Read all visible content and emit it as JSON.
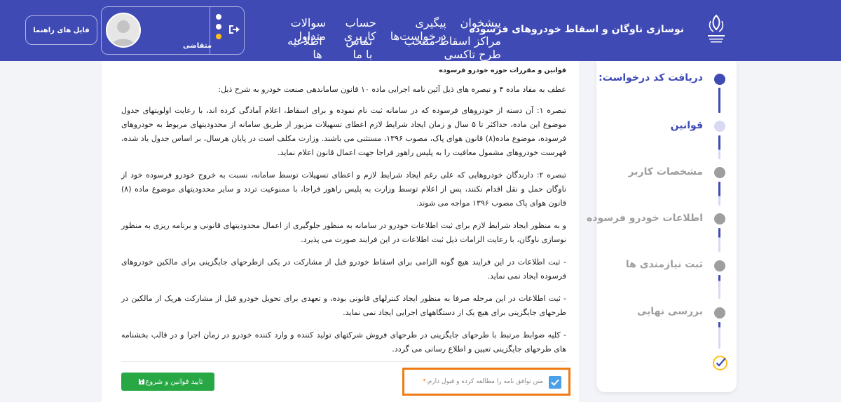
{
  "header": {
    "site_title": "نوسازی ناوگان و اسقاط خودروهای فرسوده",
    "nav_row1": [
      "پیشخوان",
      "پیگیری درخواست‌ها",
      "حساب کاربری",
      "سوالات متداول"
    ],
    "nav_row2": [
      "مراکز اسقاط منتخب طرح تاکسی",
      "تماس با ما",
      "اطلاعیه ها"
    ],
    "user_role": "متقاضی",
    "guide_button": "فایل های راهنما"
  },
  "content": {
    "doc_title": "قوانین و مقررات حوزه خودرو فرسوده",
    "paragraphs": [
      "عطف به مفاد ماده ۴ و تبصره های ذیل آئین نامه اجرایی ماده ۱۰ قانون ساماندهی صنعت خودرو به شرح ذیل:",
      "تبصره ۱: آن دسته از خودروهای فرسوده که در سامانه ثبت نام نموده و برای اسقاط، اعلام آمادگی کرده اند، با رعایت اولویتهای جدول موضوع این ماده، حداکثر تا ۵ سال و زمان ایجاد شرایط لازم اعطای تسهیلات مزبور از طریق سامانه از محدودیتهای مربوط به خودروهای فرسوده، موضوع ماده(۸) قانون هوای پاک، مصوب ۱۳۹۶، مستثنی می باشند. وزارت مکلف است در پایان هرسال، بر اساس جدول یاد شده، فهرست خودروهای مشمول معافیت را به پلیس راهور فراجا جهت اعمال قانون اعلام نماید.",
      "تبصره ۲: دارندگان خودروهایی که علی رغم ایجاد شرایط لازم و اعطای تسهیلات توسط سامانه، نسبت به خروج خودرو فرسوده خود از ناوگان حمل و نقل اقدام نکنند، پس از اعلام توسط وزارت به پلیس راهور فراجا، با ممنوعیت تردد و سایر محدودیتهای موضوع ماده (۸) قانون هوای پاک مصوب ۱۳۹۶ مواجه می شوند.",
      "و به منظور ایجاد شرایط لازم برای ثبت اطلاعات خودرو در سامانه به منظور جلوگیری از اعمال محدودیتهای قانونی و برنامه ریزی به منظور نوسازی ناوگان، با رعایت الزامات ذیل ثبت اطلاعات در این فرایند صورت می پذیرد.",
      "- ثبت اطلاعات در این فرایند هیچ گونه الزامی برای اسقاط خودرو قبل از مشارکت در یکی ازطرحهای جایگزینی برای مالکین خودروهای فرسوده ایجاد نمی نماید.",
      "- ثبت اطلاعات در این مرحله صرفا به منظور ایجاد کنترلهای قانونی بوده، و تعهدی برای تحویل خودرو قبل از مشارکت هریک از مالکین در طرحهای جایگزینی برای هیچ یک از دستگاههای اجرایی ایجاد نمی نماید.",
      "- کلیه ضوابط مرتبط با طرحهای جایگزینی در طرحهای فروش شرکتهای تولید کننده و وارد کننده خودرو در زمان اجرا و در قالب بخشنامه های طرحهای جایگزینی تعیین و اطلاع رسانی می گردد."
    ],
    "agree_label": "متن توافق نامه را مطالعه کرده و قبول دارم.",
    "agree_star": "*",
    "agree_checked": true,
    "confirm_button": "تایید قوانین و شروع"
  },
  "stepper": {
    "steps": [
      {
        "label": "دریافت کد درخواست:",
        "state": "done"
      },
      {
        "label": "قوانین",
        "state": "current"
      },
      {
        "label": "مشخصات کاربر",
        "state": "pending"
      },
      {
        "label": "اطلاعات خودرو فرسوده",
        "state": "pending"
      },
      {
        "label": "ثبت نیازمندی ها",
        "state": "pending"
      },
      {
        "label": "بررسی نهایی",
        "state": "pending"
      }
    ],
    "colors": {
      "done": "#3f4ab5",
      "current": "#d8daf3",
      "pending": "#9e9e9e",
      "label_active": "#3f4ab5",
      "label_pending": "#9e9e9e"
    }
  }
}
